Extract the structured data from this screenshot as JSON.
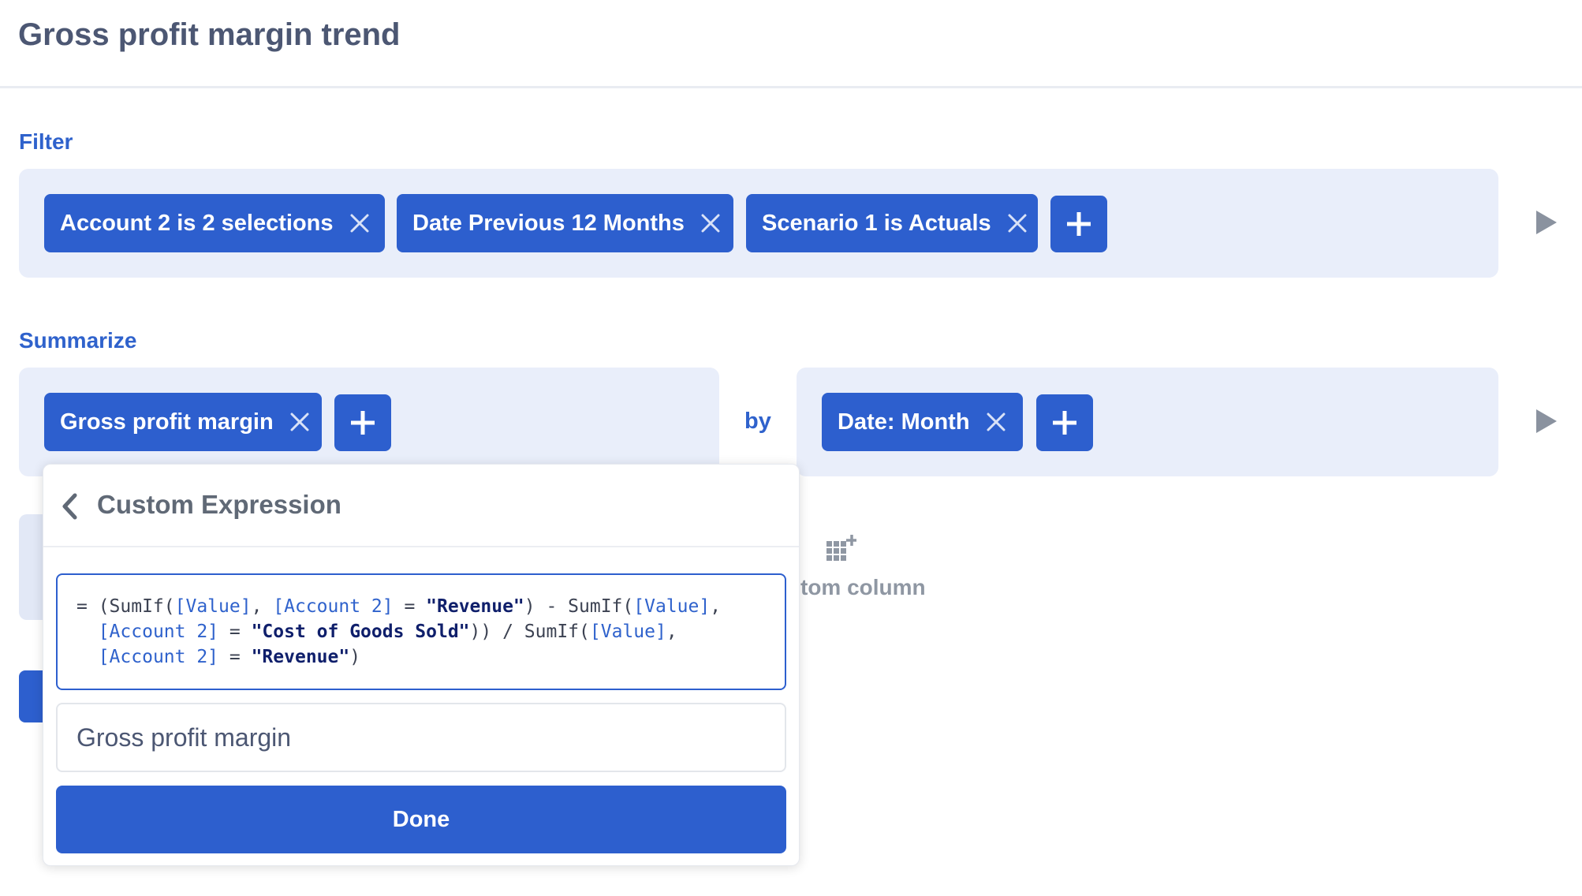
{
  "page": {
    "title": "Gross profit margin trend"
  },
  "filter": {
    "label": "Filter",
    "pills": [
      {
        "label": "Account 2 is 2 selections"
      },
      {
        "label": "Date Previous 12 Months"
      },
      {
        "label": "Scenario 1 is Actuals"
      }
    ]
  },
  "summarize": {
    "label": "Summarize",
    "metric_pills": [
      {
        "label": "Gross profit margin"
      }
    ],
    "by_label": "by",
    "group_pills": [
      {
        "label": "Date: Month"
      }
    ]
  },
  "custom_column": {
    "label": "tom column"
  },
  "popover": {
    "title": "Custom Expression",
    "expression_lines": [
      [
        {
          "t": "op",
          "v": "= ("
        },
        {
          "t": "fn",
          "v": "SumIf("
        },
        {
          "t": "field",
          "v": "[Value]"
        },
        {
          "t": "op",
          "v": ", "
        },
        {
          "t": "field",
          "v": "[Account 2]"
        },
        {
          "t": "op",
          "v": " = "
        },
        {
          "t": "str",
          "v": "\"Revenue\""
        },
        {
          "t": "op",
          "v": ") - "
        },
        {
          "t": "fn",
          "v": "SumIf("
        },
        {
          "t": "field",
          "v": "[Value]"
        },
        {
          "t": "op",
          "v": ","
        }
      ],
      [
        {
          "t": "op",
          "v": "  "
        },
        {
          "t": "field",
          "v": "[Account 2]"
        },
        {
          "t": "op",
          "v": " = "
        },
        {
          "t": "str",
          "v": "\"Cost of Goods Sold\""
        },
        {
          "t": "op",
          "v": ")) / "
        },
        {
          "t": "fn",
          "v": "SumIf("
        },
        {
          "t": "field",
          "v": "[Value]"
        },
        {
          "t": "op",
          "v": ","
        }
      ],
      [
        {
          "t": "op",
          "v": "  "
        },
        {
          "t": "field",
          "v": "[Account 2]"
        },
        {
          "t": "op",
          "v": " = "
        },
        {
          "t": "str",
          "v": "\"Revenue\""
        },
        {
          "t": "op",
          "v": ")"
        }
      ]
    ],
    "name_value": "Gross profit margin",
    "done_label": "Done"
  },
  "colors": {
    "accent": "#2d5fce",
    "panel": "#e9eefa",
    "label_blue": "#2f62cc"
  }
}
